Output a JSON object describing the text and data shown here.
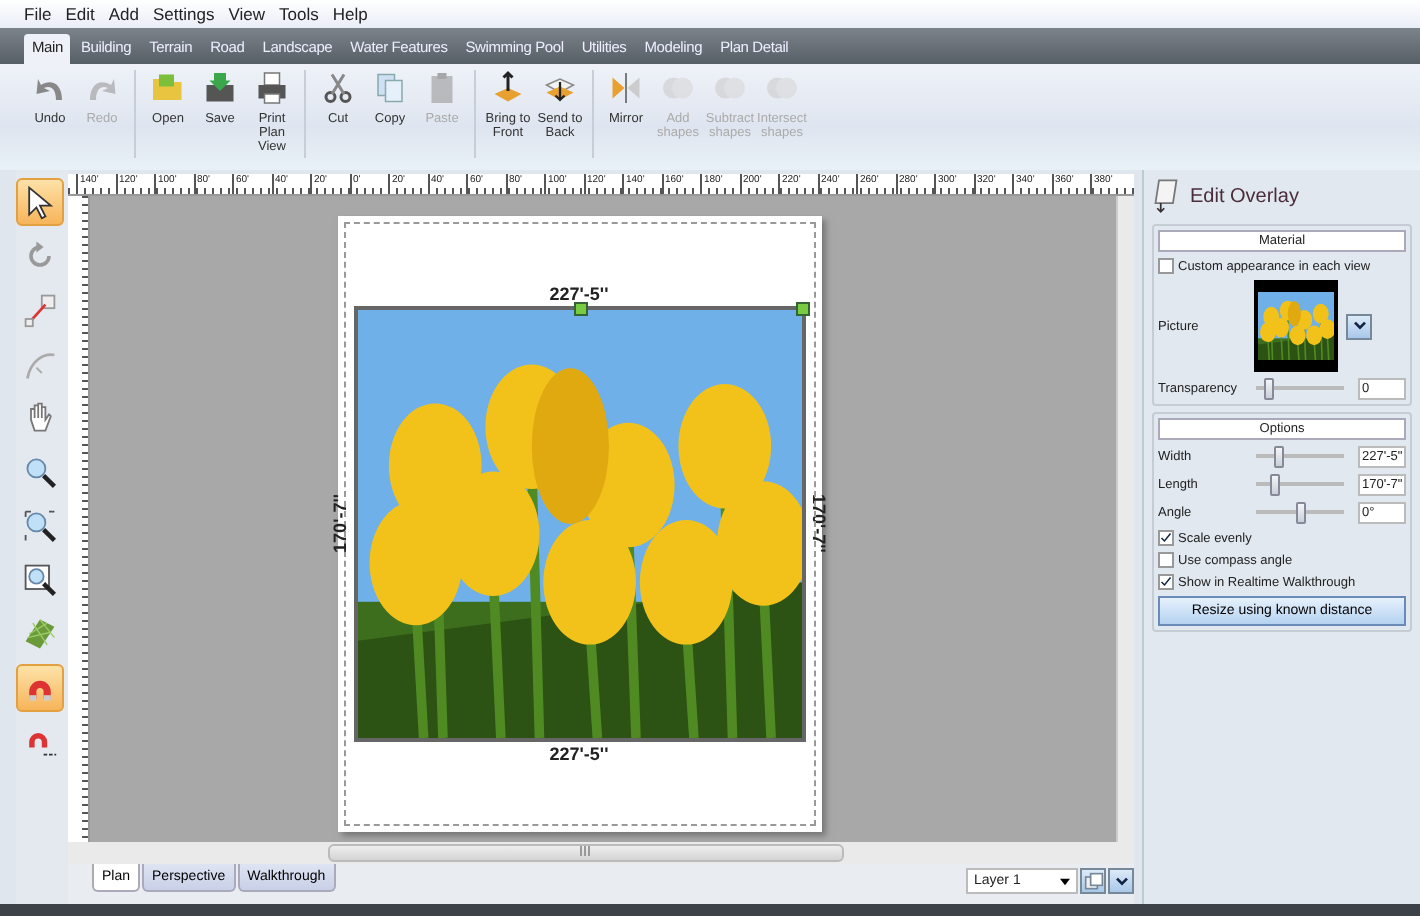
{
  "menu": [
    "File",
    "Edit",
    "Add",
    "Settings",
    "View",
    "Tools",
    "Help"
  ],
  "tabs": [
    {
      "label": "Main",
      "selected": true
    },
    {
      "label": "Building",
      "selected": false
    },
    {
      "label": "Terrain",
      "selected": false
    },
    {
      "label": "Road",
      "selected": false
    },
    {
      "label": "Landscape",
      "selected": false
    },
    {
      "label": "Water Features",
      "selected": false
    },
    {
      "label": "Swimming Pool",
      "selected": false
    },
    {
      "label": "Utilities",
      "selected": false
    },
    {
      "label": "Modeling",
      "selected": false
    },
    {
      "label": "Plan Detail",
      "selected": false
    }
  ],
  "toolbar": [
    {
      "kind": "undo",
      "label": "Undo",
      "disabled": false
    },
    {
      "kind": "redo",
      "label": "Redo",
      "disabled": true
    },
    {
      "kind": "sep"
    },
    {
      "kind": "open",
      "label": "Open",
      "disabled": false
    },
    {
      "kind": "save",
      "label": "Save",
      "disabled": false
    },
    {
      "kind": "print",
      "label": "Print Plan View",
      "disabled": false
    },
    {
      "kind": "sep"
    },
    {
      "kind": "cut",
      "label": "Cut",
      "disabled": false
    },
    {
      "kind": "copy",
      "label": "Copy",
      "disabled": false
    },
    {
      "kind": "paste",
      "label": "Paste",
      "disabled": true
    },
    {
      "kind": "sep"
    },
    {
      "kind": "front",
      "label": "Bring to Front",
      "disabled": false
    },
    {
      "kind": "back",
      "label": "Send to Back",
      "disabled": false
    },
    {
      "kind": "sep"
    },
    {
      "kind": "mirror",
      "label": "Mirror",
      "disabled": false
    },
    {
      "kind": "shapes",
      "label": "Add shapes",
      "disabled": true
    },
    {
      "kind": "shapes",
      "label": "Subtract shapes",
      "disabled": true
    },
    {
      "kind": "shapes",
      "label": "Intersect shapes",
      "disabled": true
    }
  ],
  "ruler_labels": [
    "140'",
    "120'",
    "100'",
    "80'",
    "60'",
    "40'",
    "20'",
    "0'",
    "20'",
    "40'",
    "60'",
    "80'",
    "100'",
    "120'",
    "140'",
    "160'",
    "180'",
    "200'",
    "220'",
    "240'",
    "260'",
    "280'",
    "300'",
    "320'",
    "340'",
    "360'",
    "380'"
  ],
  "tools": [
    {
      "kind": "select",
      "selected": true
    },
    {
      "kind": "rotate",
      "selected": false
    },
    {
      "kind": "line",
      "selected": false
    },
    {
      "kind": "arc",
      "selected": false
    },
    {
      "kind": "hand",
      "selected": false
    },
    {
      "kind": "zoom",
      "selected": false
    },
    {
      "kind": "zoomfit",
      "selected": false
    },
    {
      "kind": "zoomwin",
      "selected": false
    },
    {
      "kind": "grid",
      "selected": false
    },
    {
      "kind": "magnet",
      "selected": true
    },
    {
      "kind": "magnetsmall",
      "selected": false
    }
  ],
  "overlay": {
    "width_label": "227'-5''",
    "width_label_bottom": "227'-5''",
    "length_label_left": "170'-7''",
    "length_label_right": "170'-7''"
  },
  "panel": {
    "title": "Edit Overlay",
    "material_header": "Material",
    "custom_appearance": {
      "label": "Custom appearance in each view",
      "checked": false
    },
    "picture_label": "Picture",
    "transparency": {
      "label": "Transparency",
      "level": 0.1,
      "value": "0"
    },
    "options_header": "Options",
    "sliders": [
      {
        "label": "Width",
        "level": 0.22,
        "value": "227'-5\""
      },
      {
        "label": "Length",
        "level": 0.19,
        "value": "170'-7\""
      },
      {
        "label": "Angle",
        "level": 0.5,
        "value": "0°"
      }
    ],
    "checks": [
      {
        "label": "Scale evenly",
        "checked": true
      },
      {
        "label": "Use compass angle",
        "checked": false
      },
      {
        "label": "Show in Realtime Walkthrough",
        "checked": true
      }
    ],
    "resize_button": "Resize using known distance"
  },
  "view_tabs": [
    {
      "label": "Plan",
      "selected": true
    },
    {
      "label": "Perspective",
      "selected": false
    },
    {
      "label": "Walkthrough",
      "selected": false
    }
  ],
  "layer": {
    "value": "Layer 1"
  }
}
